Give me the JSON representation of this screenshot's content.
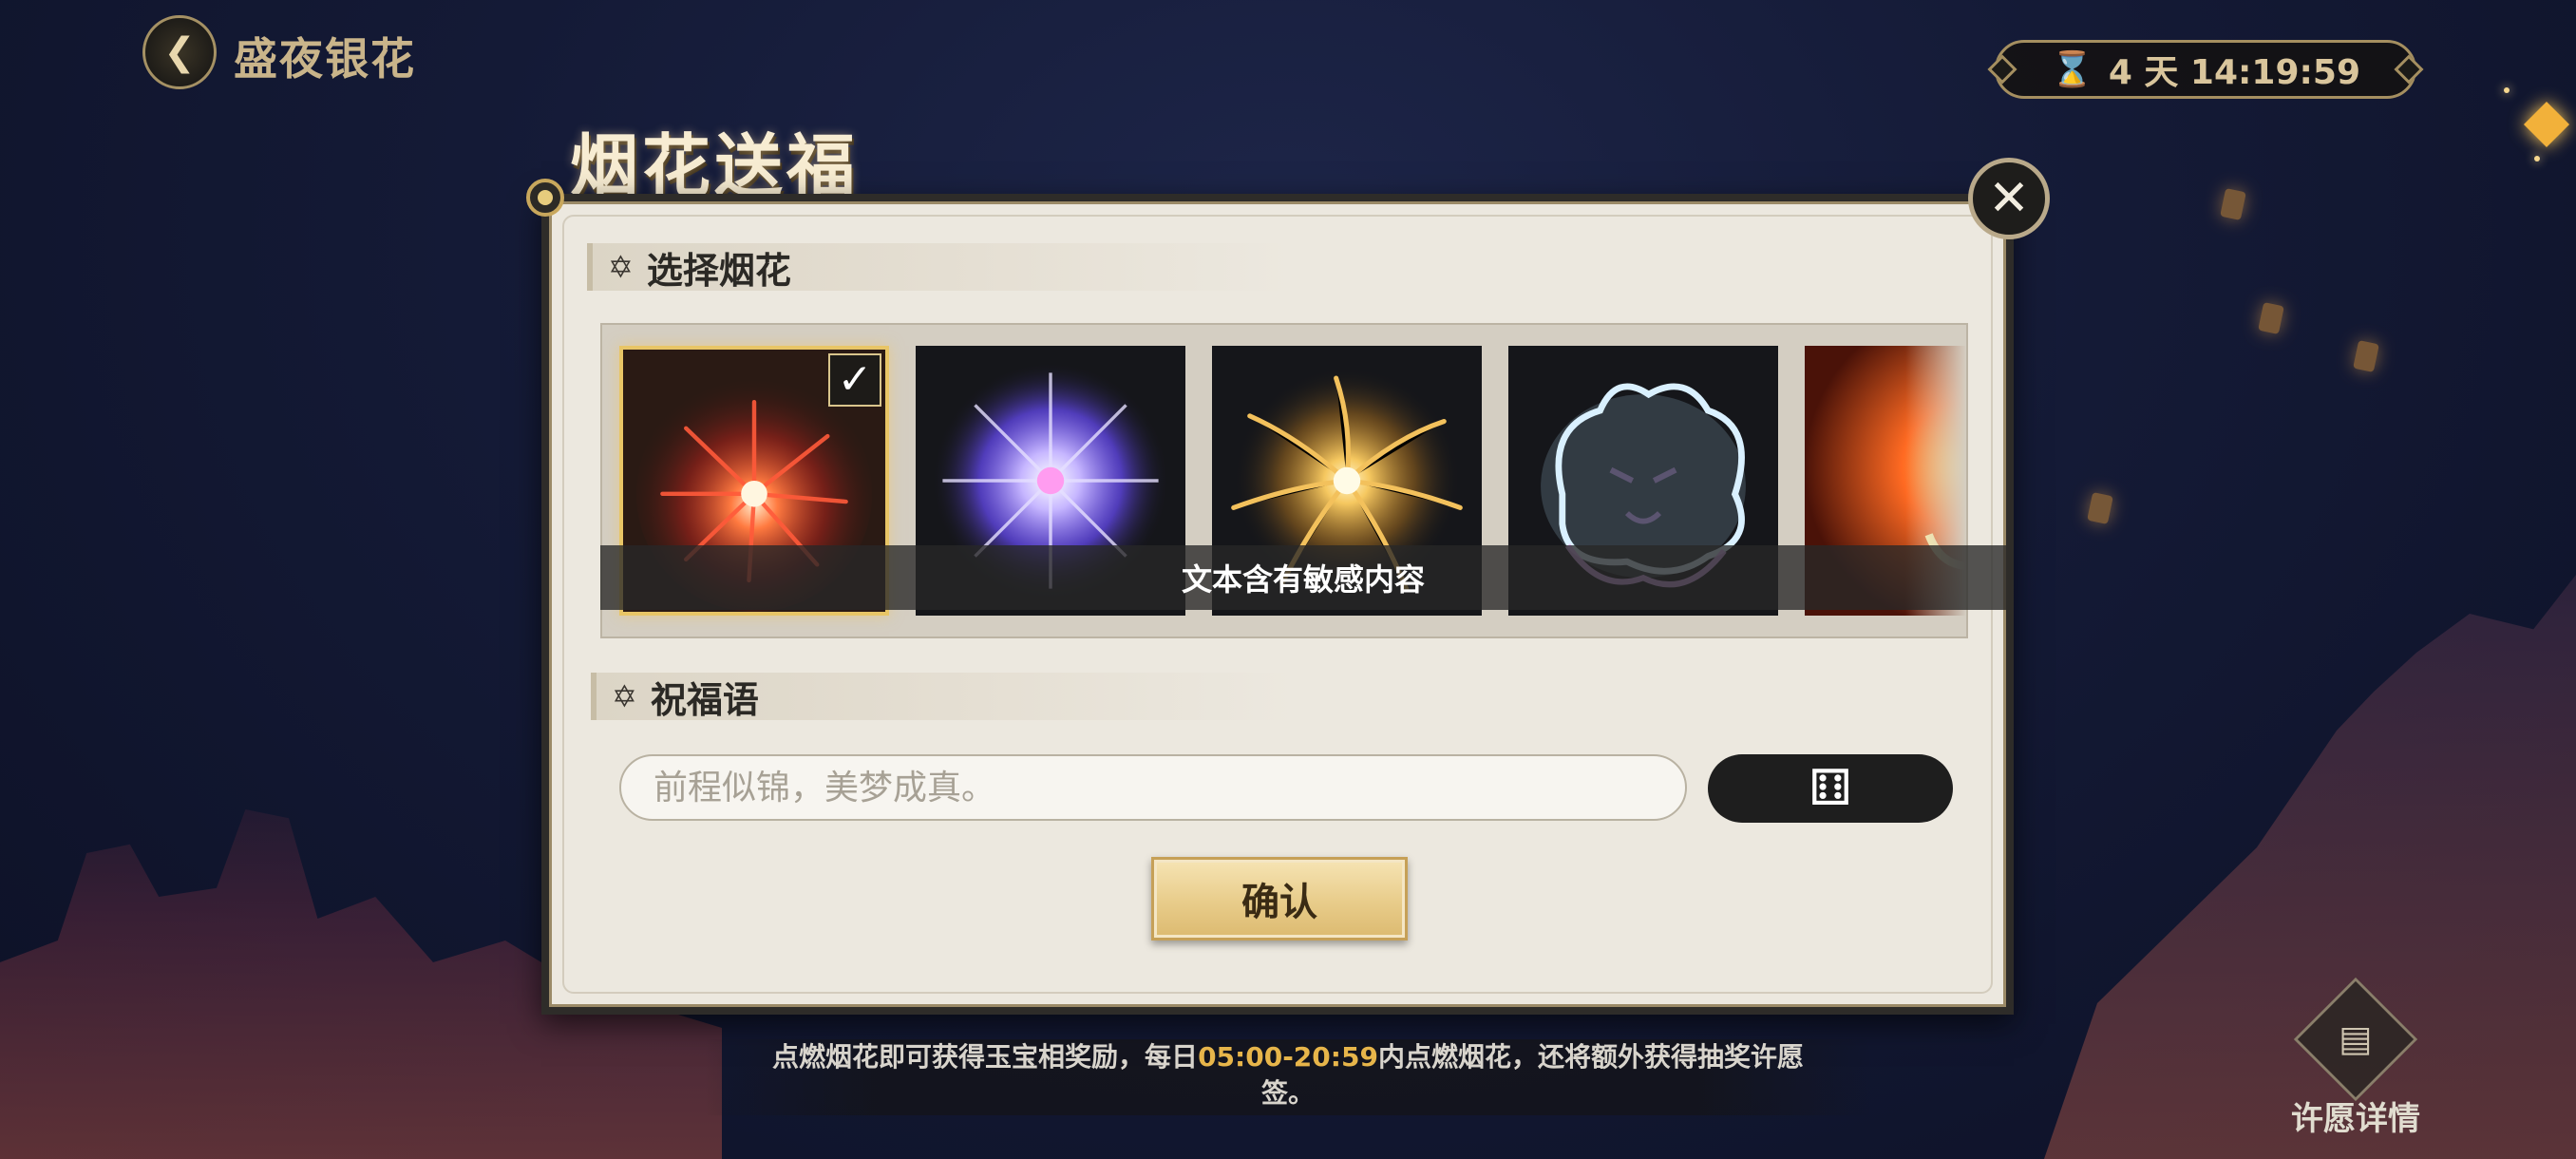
{
  "header": {
    "back_icon": "back-arrow-icon",
    "back_title": "盛夜银花",
    "timer_text": "4 天 14:19:59",
    "timer_icon": "hourglass-icon"
  },
  "title": "烟花送福",
  "panel": {
    "section_firework": "选择烟花",
    "fireworks": [
      {
        "name": "red-firework",
        "color": "#e2402f",
        "selected": true
      },
      {
        "name": "blue-firework",
        "color": "#8d7bff",
        "selected": false
      },
      {
        "name": "gold-firework",
        "color": "#f0b24a",
        "selected": false
      },
      {
        "name": "creature-firework",
        "color": "#b8e4ff",
        "selected": false
      },
      {
        "name": "fire-creature-firework",
        "color": "#ff7a2a",
        "selected": false
      }
    ],
    "sensitive_notice": "文本含有敏感内容",
    "section_blessing": "祝福语",
    "blessing_placeholder": "前程似锦，美梦成真。",
    "blessing_value": "",
    "dice_icon": "dice-icon",
    "confirm_label": "确认"
  },
  "footer": {
    "note_part1": "点燃烟花即可获得玉宝相奖励，每日",
    "note_time": "05:00-20:59",
    "note_part2": "内点燃烟花，还将额外获得抽奖许愿",
    "note_part3": "签。",
    "wish_detail_label": "许愿详情"
  },
  "colors": {
    "accent_gold": "#e8c566",
    "panel_bg": "#ece8df",
    "highlight": "#e7b54a"
  }
}
